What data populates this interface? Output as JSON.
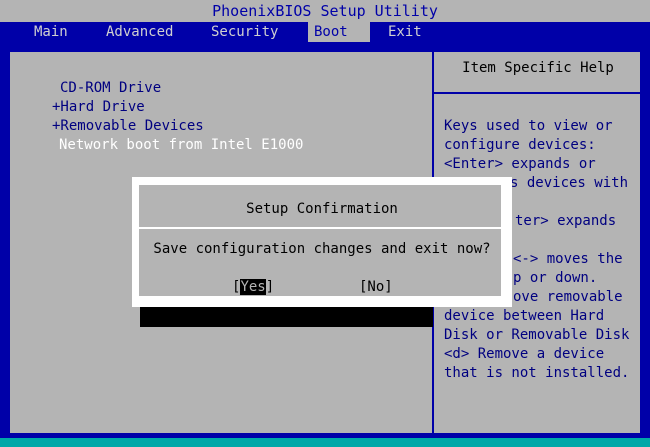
{
  "app": {
    "title": "PhoenixBIOS Setup Utility"
  },
  "menu": {
    "tabs": [
      {
        "label": "Main"
      },
      {
        "label": "Advanced"
      },
      {
        "label": "Security"
      },
      {
        "label": "Boot"
      },
      {
        "label": "Exit"
      }
    ],
    "active": "Boot"
  },
  "boot": {
    "items": [
      {
        "label": "CD-ROM Drive"
      },
      {
        "label": "+Hard Drive"
      },
      {
        "label": "+Removable Devices"
      },
      {
        "label": "Network boot from Intel E1000"
      }
    ],
    "selected_index": 3
  },
  "help": {
    "title": "Item Specific Help",
    "lines": [
      "Keys used to view or",
      "configure devices:",
      "<Enter> expands or",
      "s devices with",
      "",
      "ter> expands",
      "",
      "<-> moves the",
      "p or down.",
      "ove removable",
      "device between Hard",
      "Disk or Removable Disk",
      "<d> Remove a device",
      "that is not installed."
    ]
  },
  "dialog": {
    "title": "Setup Confirmation",
    "message": "Save configuration changes and exit now?",
    "yes_open": "[",
    "yes_label": "Yes",
    "yes_close": "]",
    "no_label": "[No]"
  },
  "colors": {
    "background": "#0000a8",
    "panel": "#b4b4b4",
    "text_blue": "#000080",
    "highlight": "#ffffff"
  }
}
